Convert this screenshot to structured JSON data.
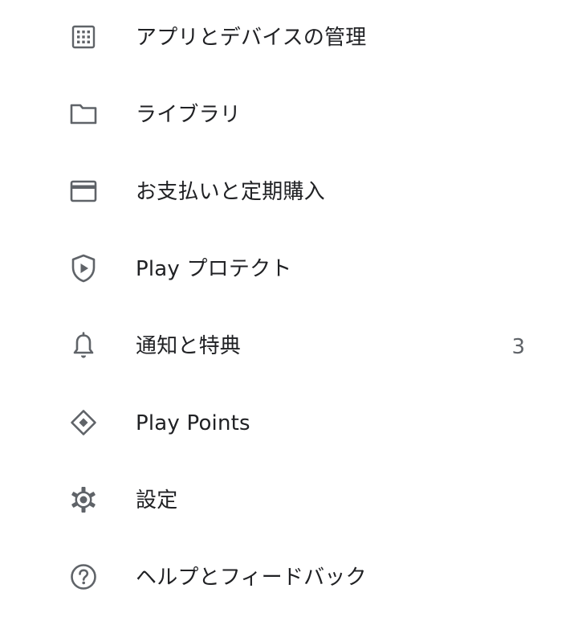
{
  "colors": {
    "label": "#202124",
    "icon": "#5f6368",
    "count": "#5f6368"
  },
  "menu": {
    "items": [
      {
        "label": "アプリとデバイスの管理",
        "icon": "apps-grid-icon"
      },
      {
        "label": "ライブラリ",
        "icon": "folder-icon"
      },
      {
        "label": "お支払いと定期購入",
        "icon": "credit-card-icon"
      },
      {
        "label": "Play プロテクト",
        "icon": "play-protect-shield-icon"
      },
      {
        "label": "通知と特典",
        "icon": "bell-icon",
        "count": "3"
      },
      {
        "label": "Play Points",
        "icon": "play-points-diamond-icon"
      },
      {
        "label": "設定",
        "icon": "gear-icon"
      },
      {
        "label": "ヘルプとフィードバック",
        "icon": "help-circle-icon"
      }
    ]
  }
}
